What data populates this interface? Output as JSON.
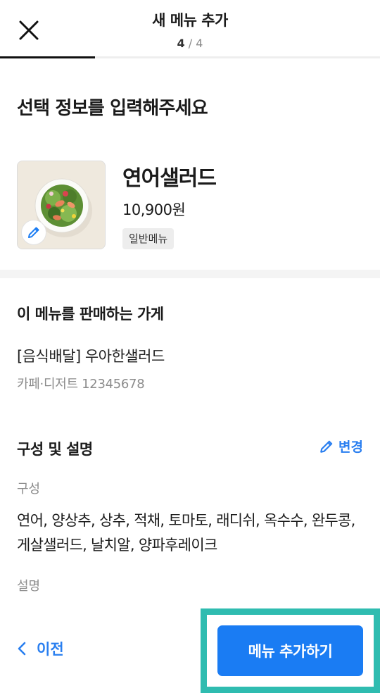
{
  "header": {
    "title": "새 메뉴 추가",
    "step_current": "4",
    "step_separator": "/",
    "step_total": "4",
    "progress_fraction": 0.25
  },
  "section_title": "선택 정보를 입력해주세요",
  "menu": {
    "name": "연어샐러드",
    "price": "10,900원",
    "badge": "일반메뉴"
  },
  "store": {
    "label": "이 메뉴를 판매하는 가게",
    "name": "[음식배달] 우아한샐러드",
    "meta": "카페·디저트 12345678"
  },
  "composition": {
    "label": "구성 및 설명",
    "change_label": "변경",
    "components_label": "구성",
    "components_text": "연어, 양상추, 상추, 적채, 토마토, 래디쉬, 옥수수, 완두콩, 게살샐러드, 날치알, 양파후레이크",
    "description_label": "설명"
  },
  "footer": {
    "prev_label": "이전",
    "add_label": "메뉴 추가하기"
  },
  "colors": {
    "accent": "#1a7cf3",
    "link": "#2a7ff0",
    "highlight": "#2fbcb0"
  },
  "icons": [
    "close-icon",
    "pencil-icon",
    "chevron-left-icon"
  ]
}
